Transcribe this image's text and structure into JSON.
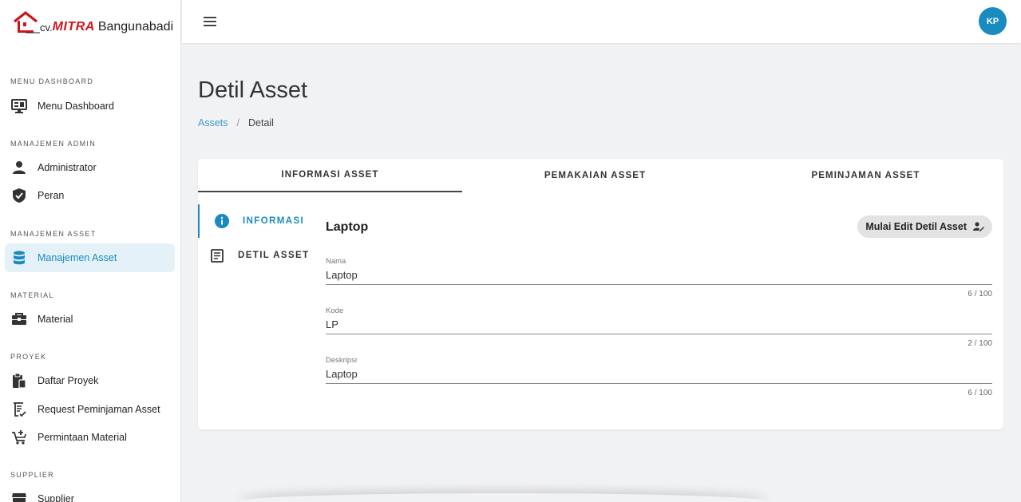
{
  "brand": {
    "prefix": "cv.",
    "name": "MITRA",
    "suffix": "Bangunabadi"
  },
  "sidebar": {
    "sections": [
      {
        "title": "MENU DASHBOARD",
        "items": [
          {
            "label": "Menu Dashboard",
            "icon": "dashboard-icon"
          }
        ]
      },
      {
        "title": "MANAJEMEN ADMIN",
        "items": [
          {
            "label": "Administrator",
            "icon": "person-icon"
          },
          {
            "label": "Peran",
            "icon": "shield-icon"
          }
        ]
      },
      {
        "title": "MANAJEMEN ASSET",
        "items": [
          {
            "label": "Manajemen Asset",
            "icon": "database-icon",
            "active": true
          }
        ]
      },
      {
        "title": "MATERIAL",
        "items": [
          {
            "label": "Material",
            "icon": "toolbox-icon"
          }
        ]
      },
      {
        "title": "PROYEK",
        "items": [
          {
            "label": "Daftar Proyek",
            "icon": "clipboard-icon"
          },
          {
            "label": "Request Peminjaman Asset",
            "icon": "request-icon"
          },
          {
            "label": "Permintaan Material",
            "icon": "cart-add-icon"
          }
        ]
      },
      {
        "title": "SUPPLIER",
        "items": [
          {
            "label": "Supplier",
            "icon": "store-icon"
          }
        ]
      }
    ]
  },
  "topbar": {
    "avatar_initials": "KP"
  },
  "page": {
    "title": "Detil Asset",
    "breadcrumb": {
      "link": "Assets",
      "separator": "/",
      "current": "Detail"
    }
  },
  "tabs": [
    "INFORMASI ASSET",
    "PEMAKAIAN ASSET",
    "PEMINJAMAN ASSET"
  ],
  "side_tabs": [
    {
      "label": "INFORMASI",
      "icon": "info-icon"
    },
    {
      "label": "DETIL ASSET",
      "icon": "document-icon"
    }
  ],
  "form": {
    "title": "Laptop",
    "edit_button": "Mulai Edit Detil Asset",
    "fields": [
      {
        "label": "Nama",
        "value": "Laptop",
        "counter": "6 / 100"
      },
      {
        "label": "Kode",
        "value": "LP",
        "counter": "2 / 100"
      },
      {
        "label": "Deskripsi",
        "value": "Laptop",
        "counter": "6 / 100"
      }
    ]
  },
  "colors": {
    "accent": "#1a8bbf",
    "brand_red": "#d1141b",
    "active_bg": "#e4f1f8",
    "page_bg": "#f1f2f4"
  }
}
